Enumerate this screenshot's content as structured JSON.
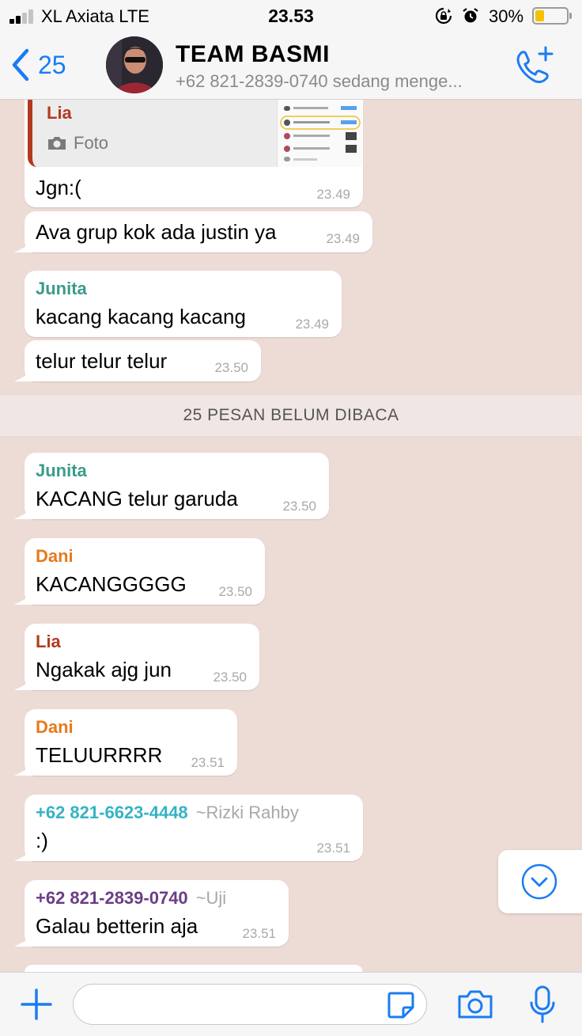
{
  "status_bar": {
    "carrier": "XL Axiata  LTE",
    "time": "23.53",
    "battery_percent": "30%",
    "battery_level": 0.3
  },
  "header": {
    "back_count": "25",
    "title": "TEAM BASMI",
    "subtitle": "+62 821-2839-0740 sedang menge..."
  },
  "quoted": {
    "sender": "Lia",
    "label": "Foto"
  },
  "messages": [
    {
      "text": "Jgn:(",
      "time": "23.49"
    },
    {
      "text": "Ava grup kok ada justin ya",
      "time": "23.49"
    },
    {
      "sender": "Junita",
      "text": "kacang kacang kacang",
      "time": "23.49"
    },
    {
      "text": "telur telur telur",
      "time": "23.50"
    },
    {
      "sender": "Junita",
      "text": "KACANG telur garuda",
      "time": "23.50"
    },
    {
      "sender": "Dani",
      "text": "KACANGGGGG",
      "time": "23.50"
    },
    {
      "sender": "Lia",
      "text": "Ngakak ajg jun",
      "time": "23.50"
    },
    {
      "sender": "Dani",
      "text": "TELUURRRR",
      "time": "23.51"
    },
    {
      "sender": "+62 821-6623-4448",
      "sender_name": "~Rizki Rahby",
      "text": ":)",
      "time": "23.51"
    },
    {
      "sender": "+62 821-2839-0740",
      "sender_name": "~Uji",
      "text": "Galau betterin aja",
      "time": "23.51"
    }
  ],
  "unread_divider": "25 PESAN BELUM DIBACA",
  "input": {
    "placeholder": ""
  },
  "colors": {
    "accent": "#1a7cf3",
    "chat_background": "#eddbd5",
    "lia": "#b23a20",
    "junita": "#3b9a8b",
    "dani": "#e57a1e",
    "rizki": "#35b3c5",
    "uji": "#6b3d86"
  },
  "icons": [
    "signal-icon",
    "lock-rotation-icon",
    "alarm-icon",
    "battery-icon",
    "back-chevron-icon",
    "add-call-icon",
    "camera-icon",
    "chevron-down-icon",
    "plus-icon",
    "sticker-icon",
    "microphone-icon"
  ]
}
